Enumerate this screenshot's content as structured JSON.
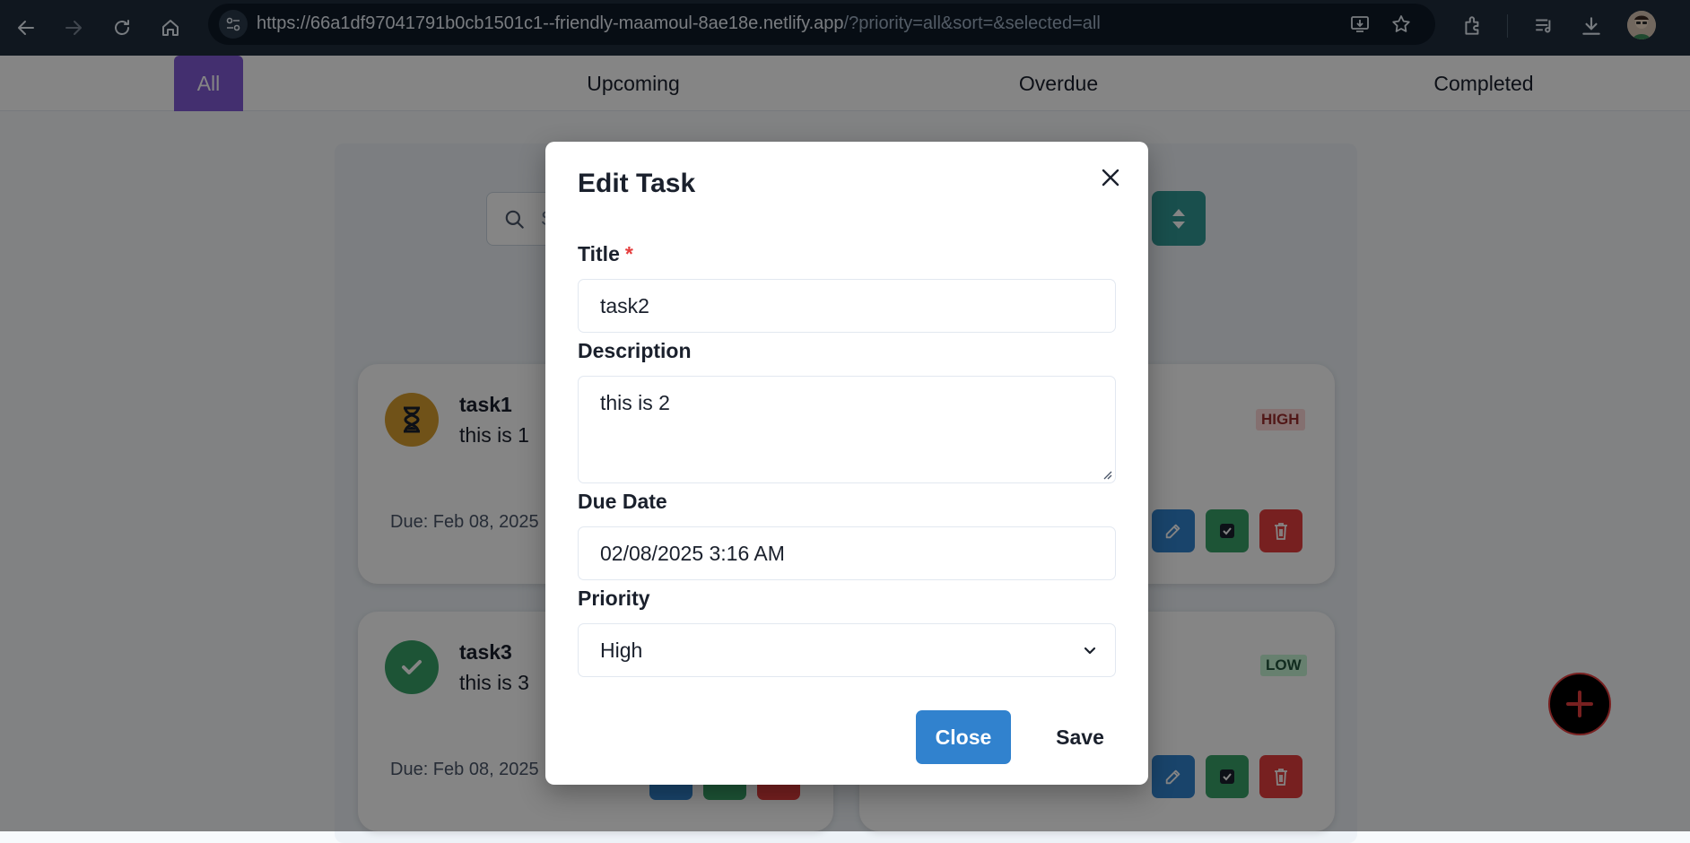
{
  "browser": {
    "url_main": "https://66a1df97041791b0cb1501c1--friendly-maamoul-8ae18e.netlify.app",
    "url_query": "/?priority=all&sort=&selected=all",
    "icons": [
      "back-icon",
      "forward-icon",
      "reload-icon",
      "home-icon",
      "site-info-icon",
      "install-icon",
      "bookmark-star-icon",
      "extensions-icon",
      "reading-list-icon",
      "downloads-icon",
      "profile-avatar"
    ]
  },
  "tabs": [
    {
      "label": "All",
      "active": true
    },
    {
      "label": "Upcoming",
      "active": false
    },
    {
      "label": "Overdue",
      "active": false
    },
    {
      "label": "Completed",
      "active": false
    }
  ],
  "search": {
    "placeholder": "S"
  },
  "tasks": [
    {
      "title": "task1",
      "description": "this is 1",
      "due": "Due: Feb 08, 2025",
      "status": "pending",
      "priority": "HIGH"
    },
    {
      "title": "task3",
      "description": "this is 3",
      "due": "Due: Feb 08, 2025",
      "status": "completed",
      "priority": "LOW"
    }
  ],
  "modal": {
    "title": "Edit Task",
    "title_label": "Title",
    "required_mark": "*",
    "title_value": "task2",
    "description_label": "Description",
    "description_value": "this is 2",
    "due_label": "Due Date",
    "due_value": "02/08/2025 3:16 AM",
    "priority_label": "Priority",
    "priority_value": "High",
    "close_label": "Close",
    "save_label": "Save"
  },
  "colors": {
    "accent_purple": "#805ad5",
    "primary_blue": "#3182ce",
    "teal": "#319795",
    "success_green": "#38a169",
    "danger_red": "#e53e3e",
    "pending_yellow": "#d69e2e"
  }
}
